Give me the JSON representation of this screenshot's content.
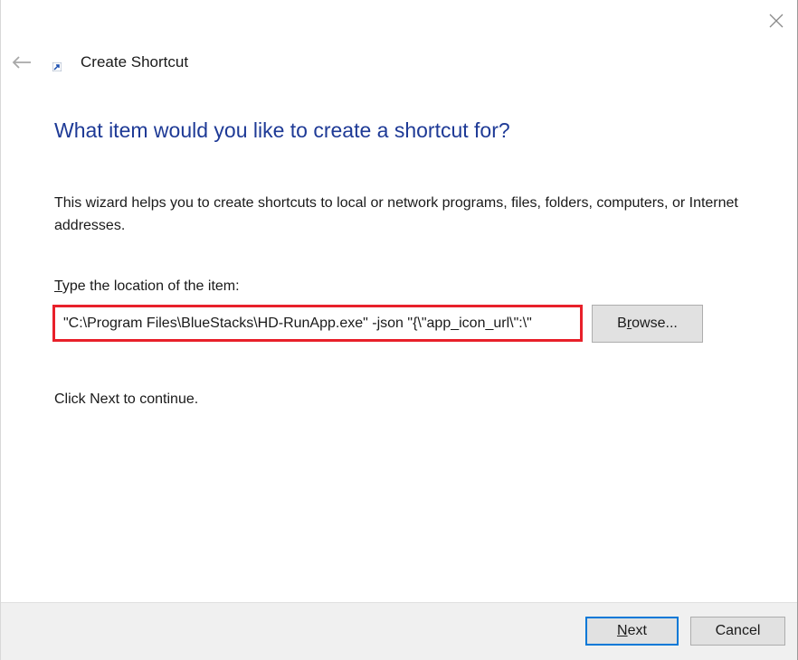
{
  "window": {
    "title": "Create Shortcut",
    "close_icon": "close-icon",
    "back_icon": "back-arrow-icon",
    "shortcut_icon": "shortcut-icon"
  },
  "main": {
    "heading": "What item would you like to create a shortcut for?",
    "description": "This wizard helps you to create shortcuts to local or network programs, files, folders, computers, or Internet addresses.",
    "location_label_accel": "T",
    "location_label_rest": "ype the location of the item:",
    "location_value": "\"C:\\Program Files\\BlueStacks\\HD-RunApp.exe\" -json \"{\\\"app_icon_url\\\":\\\"",
    "browse_accel": "r",
    "browse_pre": "B",
    "browse_post": "owse...",
    "continue_text": "Click Next to continue."
  },
  "footer": {
    "next_accel": "N",
    "next_rest": "ext",
    "cancel_label": "Cancel"
  },
  "colors": {
    "heading": "#1e3a96",
    "highlight_border": "#e8202a",
    "default_button_border": "#0078d7",
    "footer_bg": "#f0f0f0"
  }
}
